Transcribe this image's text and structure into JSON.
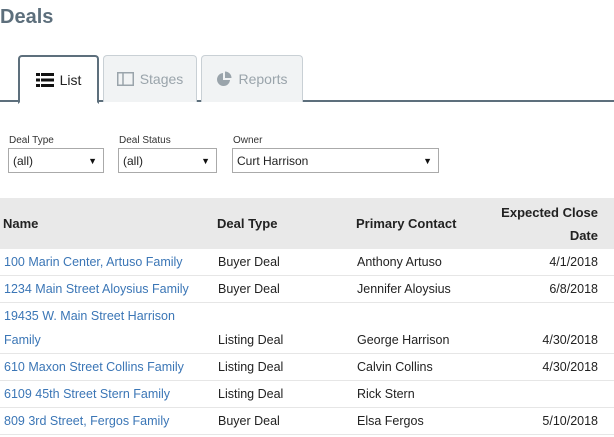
{
  "page": {
    "title": "Deals"
  },
  "tabs": [
    {
      "label": "List",
      "icon": "list-icon",
      "active": true
    },
    {
      "label": "Stages",
      "icon": "columns-icon",
      "active": false
    },
    {
      "label": "Reports",
      "icon": "pie-chart-icon",
      "active": false
    }
  ],
  "filters": {
    "deal_type": {
      "label": "Deal Type",
      "value": "(all)"
    },
    "deal_status": {
      "label": "Deal Status",
      "value": "(all)"
    },
    "owner": {
      "label": "Owner",
      "value": "Curt Harrison"
    }
  },
  "table": {
    "columns": [
      "Name",
      "Deal Type",
      "Primary Contact",
      "Expected Close",
      "Date"
    ],
    "rows": [
      {
        "name": "100 Marin Center, Artuso Family",
        "deal_type": "Buyer Deal",
        "contact": "Anthony Artuso",
        "close": "4/1/2018"
      },
      {
        "name": "1234 Main Street Aloysius Family",
        "deal_type": "Buyer Deal",
        "contact": "Jennifer Aloysius",
        "close": "6/8/2018"
      },
      {
        "name_line1": "19435 W. Main Street Harrison",
        "name_line2": "Family",
        "deal_type": "Listing Deal",
        "contact": "George Harrison",
        "close": "4/30/2018"
      },
      {
        "name": "610 Maxon Street Collins Family",
        "deal_type": "Listing Deal",
        "contact": "Calvin Collins",
        "close": "4/30/2018"
      },
      {
        "name": "6109 45th Street Stern Family",
        "deal_type": "Listing Deal",
        "contact": "Rick Stern",
        "close": ""
      },
      {
        "name": "809 3rd Street, Fergos Family",
        "deal_type": "Buyer Deal",
        "contact": "Elsa Fergos",
        "close": "5/10/2018"
      }
    ]
  },
  "colors": {
    "accent": "#5d6f7c",
    "link": "#3b76b6",
    "header_bg": "#e9e9e9"
  }
}
